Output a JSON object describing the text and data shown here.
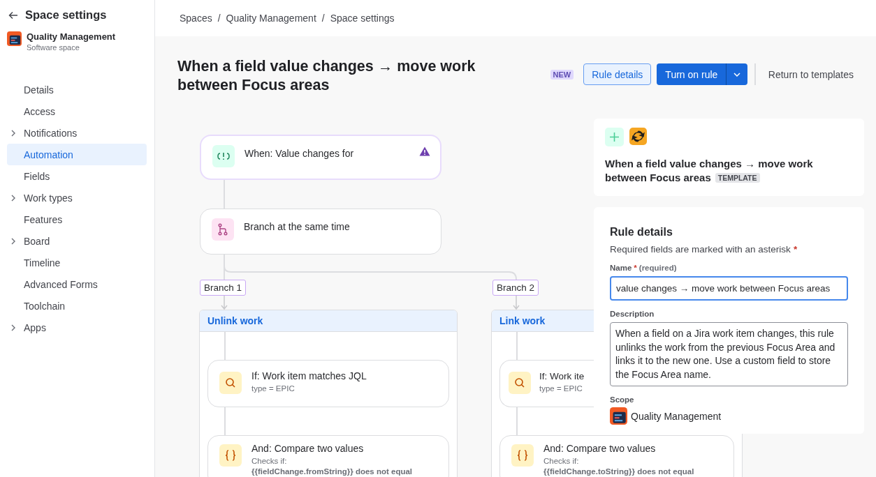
{
  "sidebar": {
    "title": "Space settings",
    "space": {
      "name": "Quality Management",
      "type": "Software space"
    },
    "items": [
      {
        "label": "Details",
        "expandable": false,
        "selected": false
      },
      {
        "label": "Access",
        "expandable": false,
        "selected": false
      },
      {
        "label": "Notifications",
        "expandable": true,
        "selected": false
      },
      {
        "label": "Automation",
        "expandable": false,
        "selected": true
      },
      {
        "label": "Fields",
        "expandable": false,
        "selected": false
      },
      {
        "label": "Work types",
        "expandable": true,
        "selected": false
      },
      {
        "label": "Features",
        "expandable": false,
        "selected": false
      },
      {
        "label": "Board",
        "expandable": true,
        "selected": false
      },
      {
        "label": "Timeline",
        "expandable": false,
        "selected": false
      },
      {
        "label": "Advanced Forms",
        "expandable": false,
        "selected": false
      },
      {
        "label": "Toolchain",
        "expandable": false,
        "selected": false
      },
      {
        "label": "Apps",
        "expandable": true,
        "selected": false
      }
    ]
  },
  "breadcrumbs": {
    "separator": "/",
    "items": [
      "Spaces",
      "Quality Management",
      "Space settings"
    ]
  },
  "header": {
    "title": "When a field value changes → move work between Focus areas",
    "badge": "NEW",
    "rule_details_button": "Rule details",
    "turn_on_button": "Turn on rule",
    "return_link": "Return to templates"
  },
  "flow": {
    "trigger": {
      "label": "When: Value changes for",
      "warning": true
    },
    "branch_node": {
      "label": "Branch at the same time"
    },
    "branches": [
      {
        "label": "Branch 1",
        "title": "Unlink work",
        "steps": [
          {
            "kind": "condition",
            "title": "If: Work item matches JQL",
            "detail": "type = EPIC"
          },
          {
            "kind": "compare",
            "title": "And: Compare two values",
            "detail": "Checks if:",
            "code": "{{fieldChange.fromString}} does not equal"
          }
        ]
      },
      {
        "label": "Branch 2",
        "title": "Link work",
        "steps": [
          {
            "kind": "condition",
            "title": "If: Work ite",
            "detail": "type = EPIC"
          },
          {
            "kind": "compare",
            "title": "And: Compare two values",
            "detail": "Checks if:",
            "code": "{{fieldChange.toString}} does not equal"
          }
        ]
      }
    ]
  },
  "template_card": {
    "title": "When a field value changes → move work between Focus areas",
    "tag": "TEMPLATE"
  },
  "details": {
    "heading": "Rule details",
    "note": "Required fields are marked with an asterisk",
    "required_mark": "*",
    "name_label": "Name",
    "name_hint": "(required)",
    "name_value": "value changes → move work between Focus areas",
    "description_label": "Description",
    "description": "When a field on a Jira work item changes, this rule unlinks the work from the previous Focus Area and links it to the new one. Use a custom field to store the Focus Area name.",
    "scope_label": "Scope",
    "scope": "Quality Management"
  }
}
